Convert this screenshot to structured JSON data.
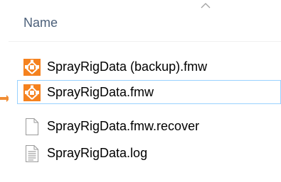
{
  "header": {
    "name_column": "Name",
    "sort_icon": "chevron-up-icon"
  },
  "files": [
    {
      "name": "SprayRigData (backup).fmw",
      "icon": "fme-workspace-icon",
      "selected": false
    },
    {
      "name": "SprayRigData.fmw",
      "icon": "fme-workspace-icon",
      "selected": true
    },
    {
      "name": "SprayRigData.fmw.recover",
      "icon": "blank-file-icon",
      "selected": false
    },
    {
      "name": "SprayRigData.log",
      "icon": "text-file-icon",
      "selected": false
    }
  ],
  "colors": {
    "fme_orange": "#f5821f",
    "selection_border": "#99d1ff",
    "header_text": "#4c607a",
    "pointer": "#f08c33"
  }
}
